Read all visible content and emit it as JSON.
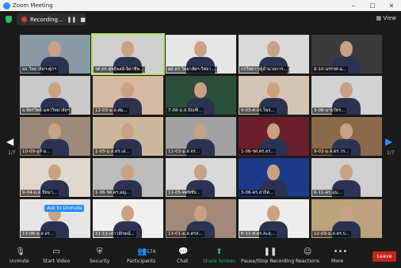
{
  "window": {
    "title": "Zoom Meeting",
    "controls": [
      "–",
      "☐",
      "✕"
    ]
  },
  "topbar": {
    "recording": "Recording...",
    "pause": "❚❚",
    "stop": "■",
    "view": "View"
  },
  "paging": {
    "current": "1/7",
    "left": "◀",
    "right": "▶"
  },
  "tiles": [
    {
      "name": "ผอ.วิทยาลัยฯ-ศุภฯ",
      "bg": "#8a9aa5"
    },
    {
      "name": "รศ.ดร.ศุทธิพงษ์-จิดาชิพ...",
      "bg": "#cfcfcf"
    },
    {
      "name": "ผศ.ดร.วิทยาลัยฯ-วิทยา...",
      "bg": "#e6e6e6"
    },
    {
      "name": "กรวิทยาฯ/ผู้อำนวยการ...",
      "bg": "#d9d9d9"
    },
    {
      "name": "8-10-นรรรศ-ม...",
      "bg": "#3b3b3b"
    },
    {
      "name": "อ.จิตรวิทย์-มหาวิทยาลัยฯ",
      "bg": "#c9c9c9"
    },
    {
      "name": "12-03-ม.ฮ.ศม...",
      "bg": "#d5b9a3"
    },
    {
      "name": "7-08-ม.ส.บัณฑิ...",
      "bg": "#2a4f3a"
    },
    {
      "name": "9-03-ศ.ดร.ไพร...",
      "bg": "#d3c4b4"
    },
    {
      "name": "3-06-นายวัทร...",
      "bg": "#d3d3d3"
    },
    {
      "name": "10-09-ลูลั-ม...",
      "bg": "#9d8a7a"
    },
    {
      "name": "1-03-ม.ส.ดร.เส...",
      "bg": "#cbb89c"
    },
    {
      "name": "12-03-ม.ส.อร...",
      "bg": "#a2a2a2"
    },
    {
      "name": "1-06-รศ.ดร.อร...",
      "bg": "#6a1f2a"
    },
    {
      "name": "9-03-ม.ส.ดร.วร...",
      "bg": "#8a6a4a"
    },
    {
      "name": "9-04-ม.ส.ปัทมา...",
      "bg": "#e0d8cc"
    },
    {
      "name": "1-06-รศ.ดร.อญ...",
      "bg": "#bdbdbd"
    },
    {
      "name": "11-05-ทศพิชัย...",
      "bg": "#d9d9d9"
    },
    {
      "name": "3-06-ดร.สาธิต...",
      "bg": "#1e3a8a"
    },
    {
      "name": "6-11-ดร.ฉุน...",
      "bg": "#cfcfcf"
    },
    {
      "name": "13-06-ม.ส.อร...",
      "bg": "#e5e5e5"
    },
    {
      "name": "11-11-เสาวลักษณ์...",
      "bg": "#f0f0f0"
    },
    {
      "name": "13-01-ม.ส.ครส...",
      "bg": "#a3897a"
    },
    {
      "name": "6-11-ศ.ดร.สะลุ...",
      "bg": "#ededed"
    },
    {
      "name": "12-09-ม.ส.ดร.บ...",
      "bg": "#bca37e"
    }
  ],
  "overlay": {
    "ask_unmute": "Ask to Unmute"
  },
  "toolbar": {
    "unmute": "Unmute",
    "start_video": "Start Video",
    "security": "Security",
    "participants": "Participants",
    "participants_count": "174",
    "chat": "Chat",
    "share_screen": "Share Screen",
    "pause_stop_recording": "Pause/Stop Recording",
    "reactions": "Reactions",
    "more": "More",
    "leave": "Leave"
  }
}
